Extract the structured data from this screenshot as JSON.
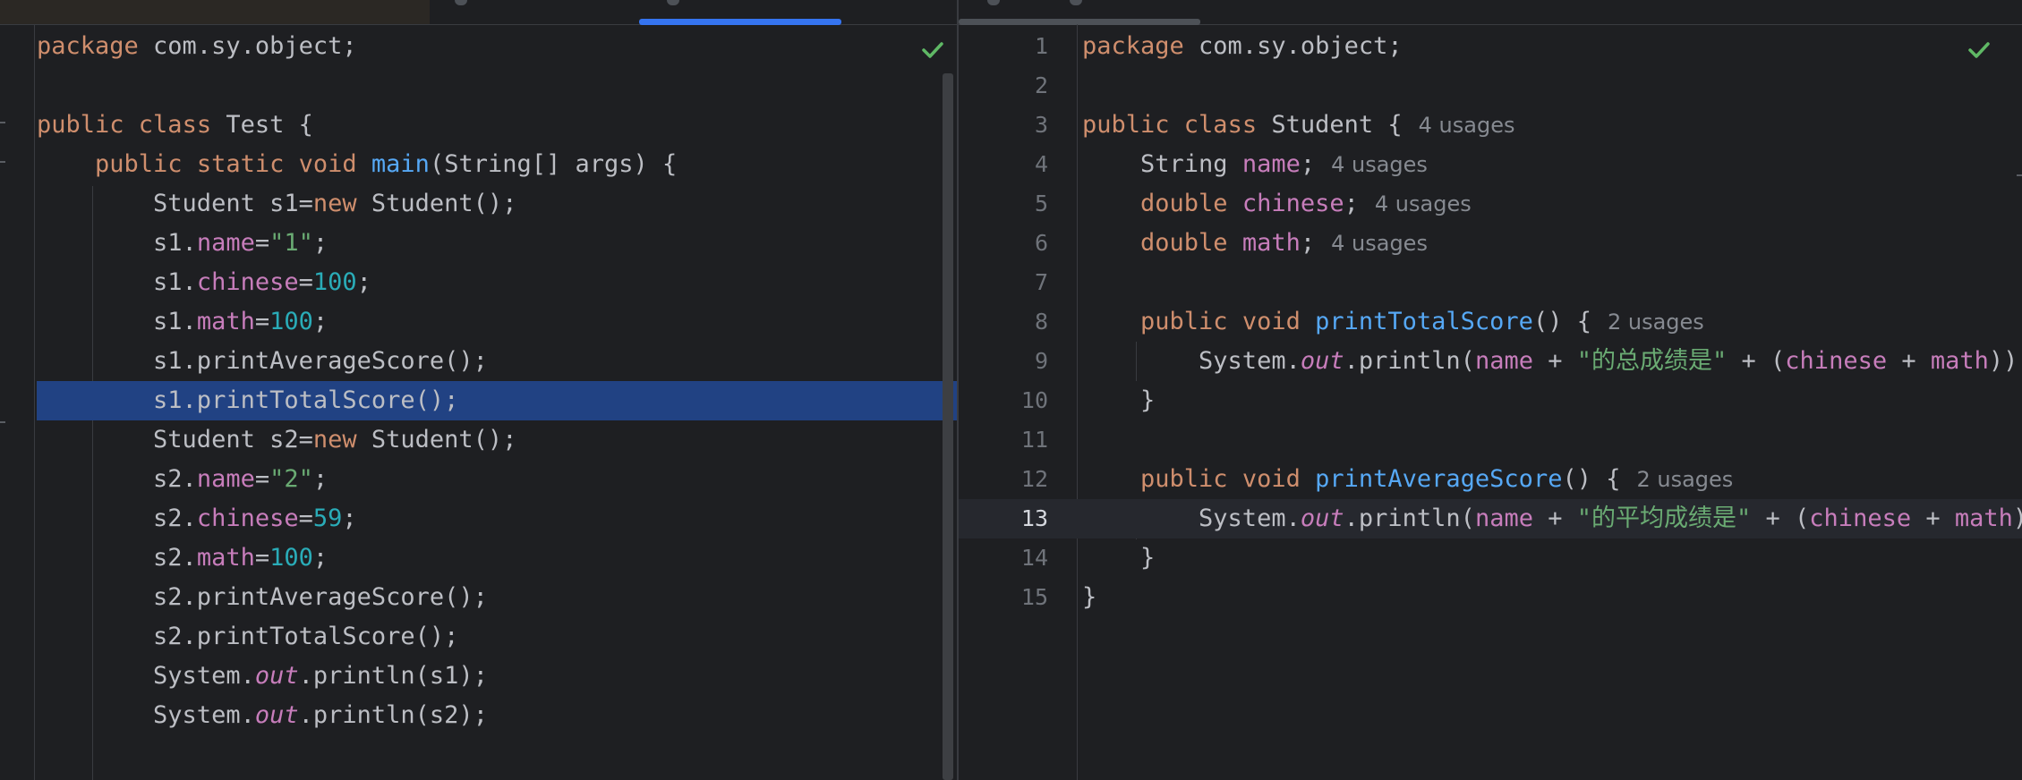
{
  "theme": {
    "background": "#1e1f22",
    "selection": "#214283",
    "accent": "#3574f0",
    "keyword": "#cf8e6d",
    "method": "#56a8f5",
    "field": "#c77dbb",
    "number": "#2aacb8",
    "string": "#6aab73",
    "check_color": "#5fb865"
  },
  "left_editor": {
    "file_status_icon": "check-icon",
    "lines": [
      {
        "tokens": [
          {
            "t": "package ",
            "c": "kw"
          },
          {
            "t": "com.sy.object;",
            "c": ""
          }
        ]
      },
      {
        "tokens": []
      },
      {
        "tokens": [
          {
            "t": "public ",
            "c": "kw"
          },
          {
            "t": "class ",
            "c": "kw"
          },
          {
            "t": "Test {",
            "c": ""
          }
        ]
      },
      {
        "tokens": [
          {
            "t": "    "
          },
          {
            "t": "public ",
            "c": "kw"
          },
          {
            "t": "static ",
            "c": "kw"
          },
          {
            "t": "void ",
            "c": "kw"
          },
          {
            "t": "main",
            "c": "fn"
          },
          {
            "t": "(String[] args) {",
            "c": ""
          }
        ]
      },
      {
        "tokens": [
          {
            "t": "        Student s1="
          },
          {
            "t": "new ",
            "c": "kw"
          },
          {
            "t": "Student();"
          }
        ]
      },
      {
        "tokens": [
          {
            "t": "        s1."
          },
          {
            "t": "name",
            "c": "fd"
          },
          {
            "t": "="
          },
          {
            "t": "\"1\"",
            "c": "str"
          },
          {
            "t": ";"
          }
        ]
      },
      {
        "tokens": [
          {
            "t": "        s1."
          },
          {
            "t": "chinese",
            "c": "fd"
          },
          {
            "t": "="
          },
          {
            "t": "100",
            "c": "num"
          },
          {
            "t": ";"
          }
        ]
      },
      {
        "tokens": [
          {
            "t": "        s1."
          },
          {
            "t": "math",
            "c": "fd"
          },
          {
            "t": "="
          },
          {
            "t": "100",
            "c": "num"
          },
          {
            "t": ";"
          }
        ]
      },
      {
        "tokens": [
          {
            "t": "        s1.printAverageScore();"
          }
        ]
      },
      {
        "tokens": [
          {
            "t": "        s1.printTotalScore();"
          }
        ],
        "highlight": true
      },
      {
        "tokens": [
          {
            "t": "        Student s2="
          },
          {
            "t": "new ",
            "c": "kw"
          },
          {
            "t": "Student();"
          }
        ]
      },
      {
        "tokens": [
          {
            "t": "        s2."
          },
          {
            "t": "name",
            "c": "fd"
          },
          {
            "t": "="
          },
          {
            "t": "\"2\"",
            "c": "str"
          },
          {
            "t": ";"
          }
        ]
      },
      {
        "tokens": [
          {
            "t": "        s2."
          },
          {
            "t": "chinese",
            "c": "fd"
          },
          {
            "t": "="
          },
          {
            "t": "59",
            "c": "num"
          },
          {
            "t": ";"
          }
        ]
      },
      {
        "tokens": [
          {
            "t": "        s2."
          },
          {
            "t": "math",
            "c": "fd"
          },
          {
            "t": "="
          },
          {
            "t": "100",
            "c": "num"
          },
          {
            "t": ";"
          }
        ]
      },
      {
        "tokens": [
          {
            "t": "        s2.printAverageScore();"
          }
        ]
      },
      {
        "tokens": [
          {
            "t": "        s2.printTotalScore();"
          }
        ]
      },
      {
        "tokens": [
          {
            "t": "        System."
          },
          {
            "t": "out",
            "c": "st"
          },
          {
            "t": ".println(s1);"
          }
        ]
      },
      {
        "tokens": [
          {
            "t": "        System."
          },
          {
            "t": "out",
            "c": "st"
          },
          {
            "t": ".println(s2);"
          }
        ]
      }
    ]
  },
  "right_editor": {
    "file_status_icon": "check-icon",
    "current_line": 13,
    "lines": [
      {
        "num": "1",
        "tokens": [
          {
            "t": "package ",
            "c": "kw"
          },
          {
            "t": "com.sy.object;"
          }
        ]
      },
      {
        "num": "2",
        "tokens": []
      },
      {
        "num": "3",
        "tokens": [
          {
            "t": "public ",
            "c": "kw"
          },
          {
            "t": "class ",
            "c": "kw"
          },
          {
            "t": "Student {"
          }
        ],
        "hint": "4 usages"
      },
      {
        "num": "4",
        "tokens": [
          {
            "t": "    String "
          },
          {
            "t": "name",
            "c": "fd"
          },
          {
            "t": ";"
          }
        ],
        "hint": "4 usages"
      },
      {
        "num": "5",
        "tokens": [
          {
            "t": "    "
          },
          {
            "t": "double ",
            "c": "kw"
          },
          {
            "t": "chinese",
            "c": "fd"
          },
          {
            "t": ";"
          }
        ],
        "hint": "4 usages"
      },
      {
        "num": "6",
        "tokens": [
          {
            "t": "    "
          },
          {
            "t": "double ",
            "c": "kw"
          },
          {
            "t": "math",
            "c": "fd"
          },
          {
            "t": ";"
          }
        ],
        "hint": "4 usages"
      },
      {
        "num": "7",
        "tokens": []
      },
      {
        "num": "8",
        "tokens": [
          {
            "t": "    "
          },
          {
            "t": "public ",
            "c": "kw"
          },
          {
            "t": "void ",
            "c": "kw"
          },
          {
            "t": "printTotalScore",
            "c": "fn"
          },
          {
            "t": "() {"
          }
        ],
        "hint": "2 usages"
      },
      {
        "num": "9",
        "tokens": [
          {
            "t": "        System."
          },
          {
            "t": "out",
            "c": "st"
          },
          {
            "t": ".println("
          },
          {
            "t": "name",
            "c": "fd"
          },
          {
            "t": " + "
          },
          {
            "t": "\"的总成绩是\"",
            "c": "str"
          },
          {
            "t": " + ("
          },
          {
            "t": "chinese",
            "c": "fd"
          },
          {
            "t": " + "
          },
          {
            "t": "math",
            "c": "fd"
          },
          {
            "t": "))"
          }
        ]
      },
      {
        "num": "10",
        "tokens": [
          {
            "t": "    }"
          }
        ]
      },
      {
        "num": "11",
        "tokens": []
      },
      {
        "num": "12",
        "tokens": [
          {
            "t": "    "
          },
          {
            "t": "public ",
            "c": "kw"
          },
          {
            "t": "void ",
            "c": "kw"
          },
          {
            "t": "printAverageScore",
            "c": "fn"
          },
          {
            "t": "() {"
          }
        ],
        "hint": "2 usages"
      },
      {
        "num": "13",
        "tokens": [
          {
            "t": "        System."
          },
          {
            "t": "out",
            "c": "st"
          },
          {
            "t": ".println("
          },
          {
            "t": "name",
            "c": "fd"
          },
          {
            "t": " + "
          },
          {
            "t": "\"的平均成绩是\"",
            "c": "str"
          },
          {
            "t": " + ("
          },
          {
            "t": "chinese",
            "c": "fd"
          },
          {
            "t": " + "
          },
          {
            "t": "math",
            "c": "fd"
          },
          {
            "t": ")"
          }
        ]
      },
      {
        "num": "14",
        "tokens": [
          {
            "t": "    }"
          }
        ]
      },
      {
        "num": "15",
        "tokens": [
          {
            "t": "}"
          }
        ]
      }
    ]
  }
}
